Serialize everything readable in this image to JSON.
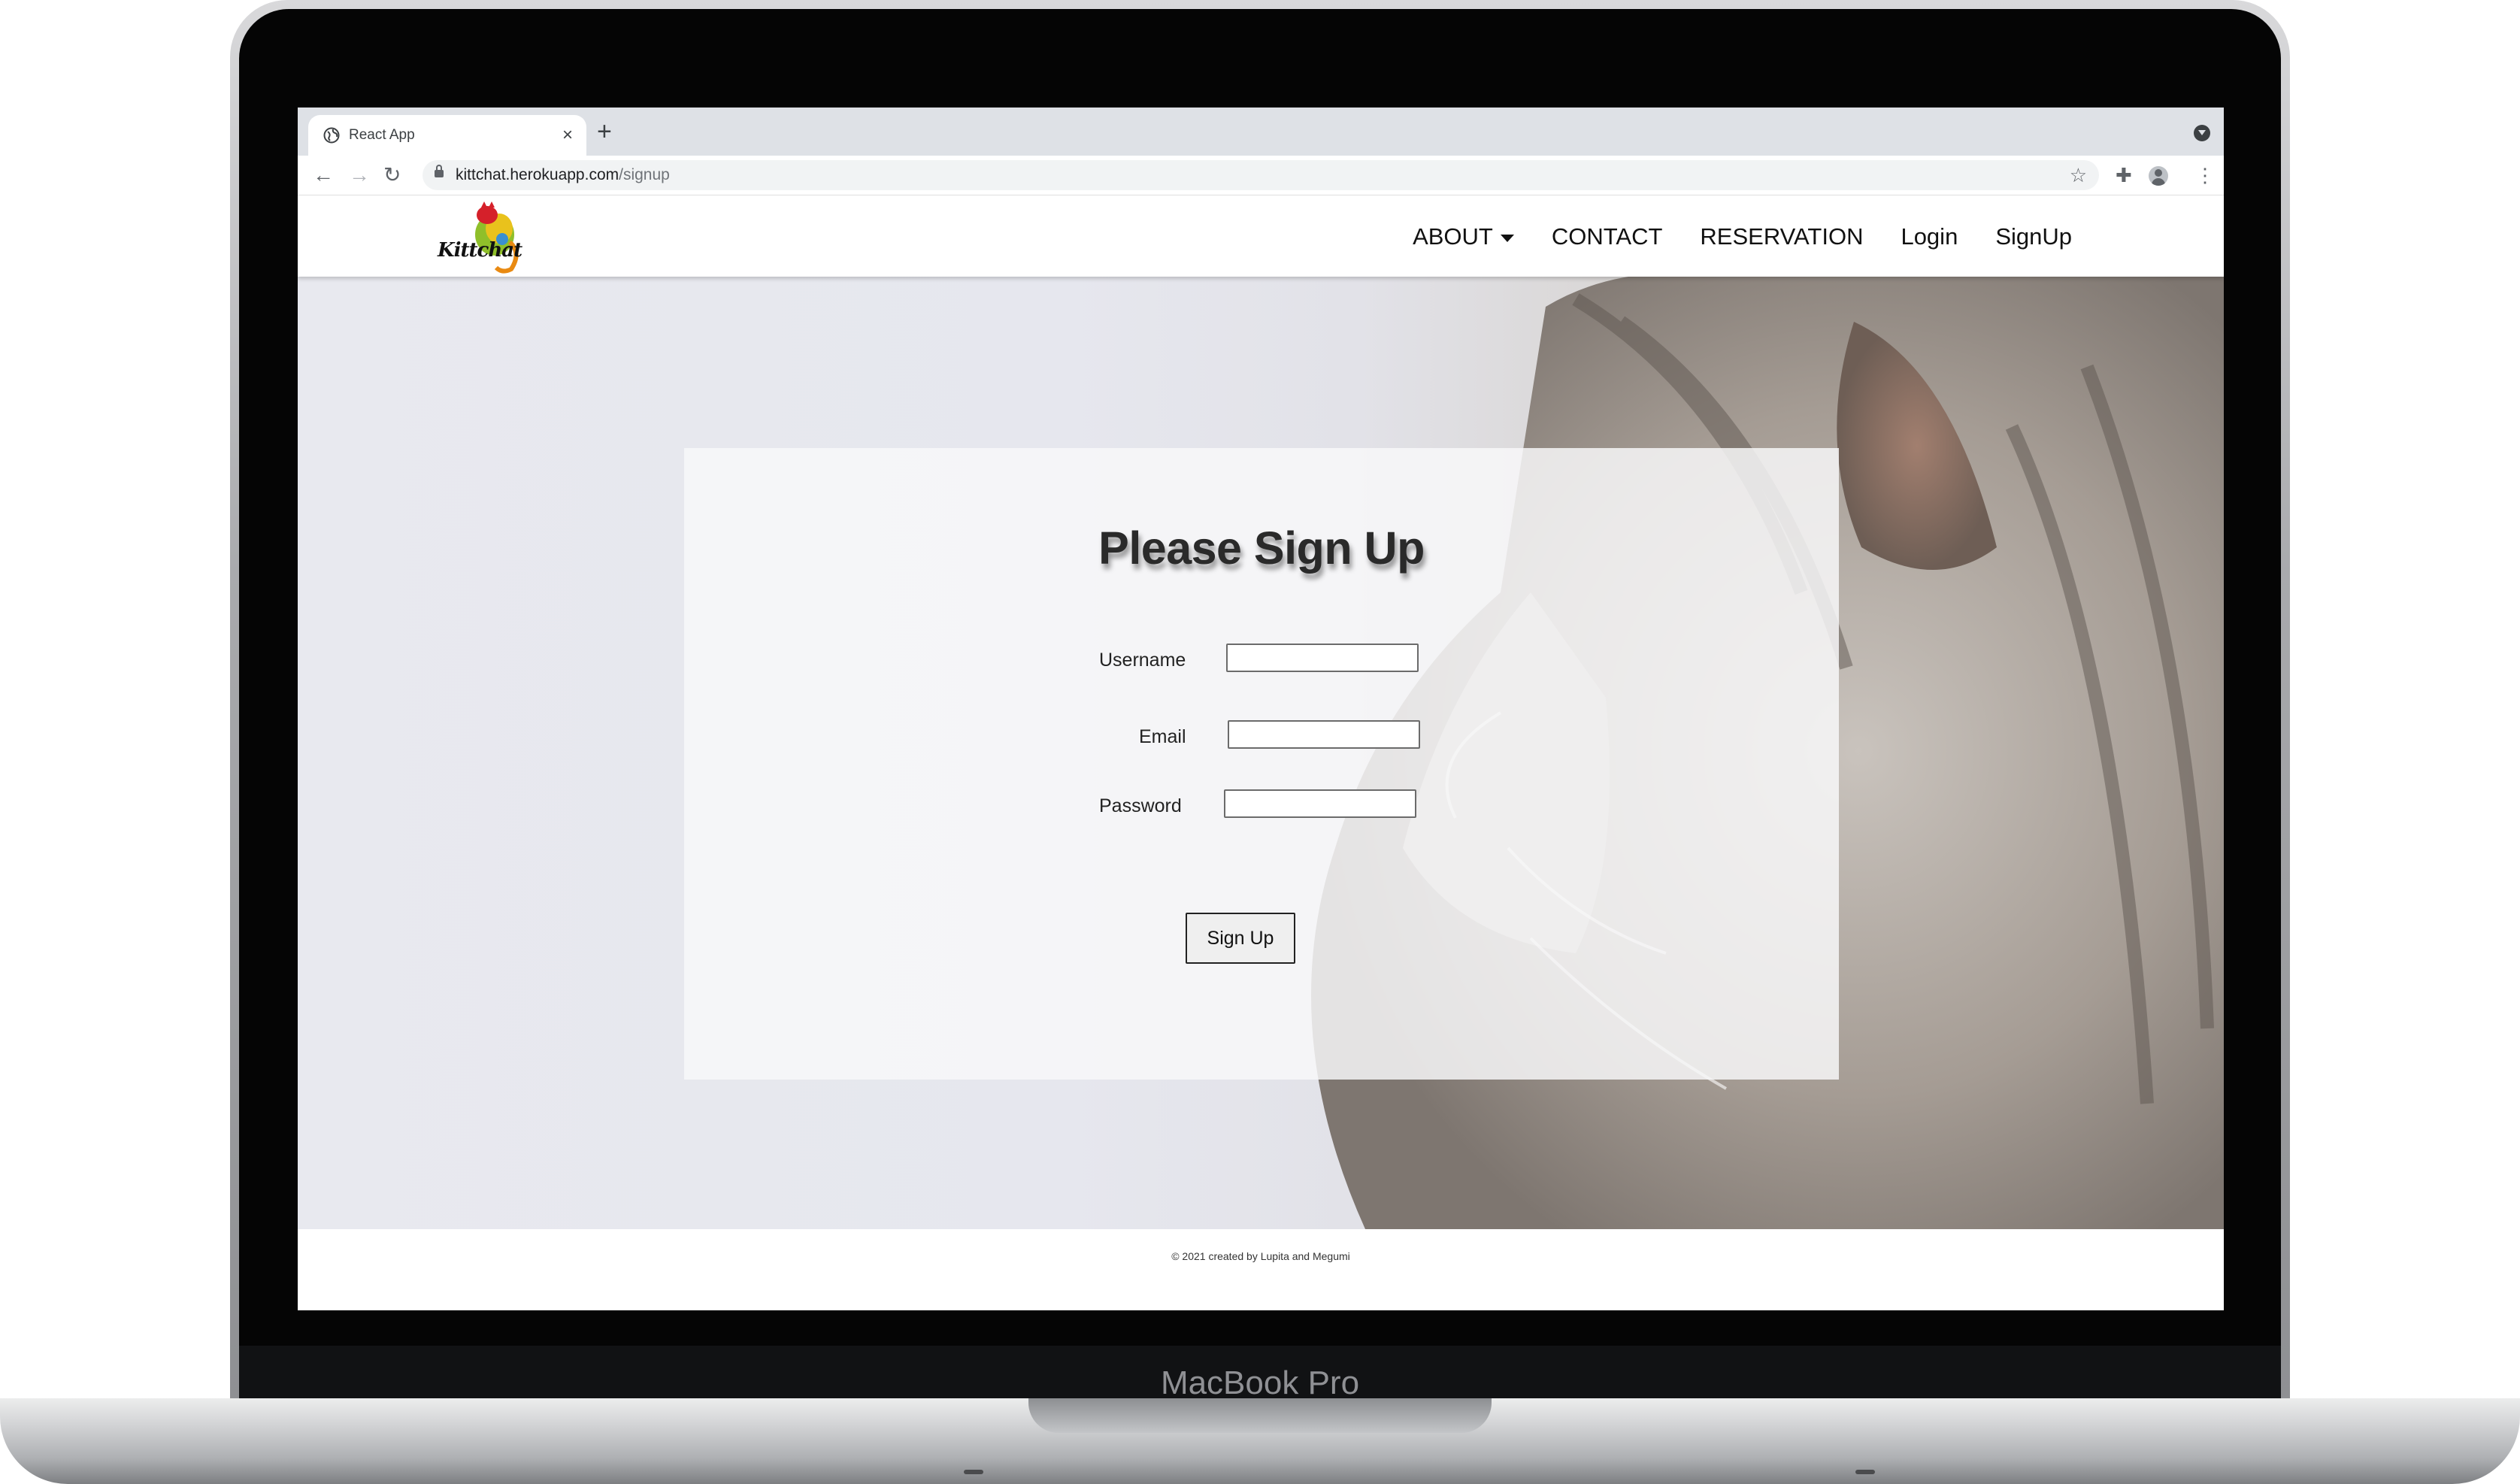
{
  "device": {
    "label": "MacBook Pro"
  },
  "browser": {
    "tab": {
      "title": "React App",
      "close_glyph": "×"
    },
    "new_tab_glyph": "+",
    "address": {
      "host": "kittchat.herokuapp.com",
      "path": "/signup"
    },
    "icons": {
      "back": "arrow-left",
      "forward": "arrow-right",
      "reload": "reload",
      "bookmark": "star",
      "extensions": "puzzle",
      "profile": "person",
      "menu": "kebab"
    }
  },
  "site": {
    "logo_text": "Kittchat",
    "nav": {
      "about": "ABOUT",
      "contact": "CONTACT",
      "reservation": "RESERVATION",
      "login": "Login",
      "signup": "SignUp"
    },
    "form": {
      "title": "Please Sign Up",
      "username_label": "Username",
      "email_label": "Email",
      "password_label": "Password",
      "username_value": "",
      "email_value": "",
      "password_value": "",
      "submit_label": "Sign Up"
    },
    "footer": {
      "text": "© 2021 created by Lupita and Megumi"
    }
  },
  "colors": {
    "tab_strip": "#dee1e6",
    "page_bg": "#e6e7ee",
    "card_bg": "#f7f7f8"
  }
}
